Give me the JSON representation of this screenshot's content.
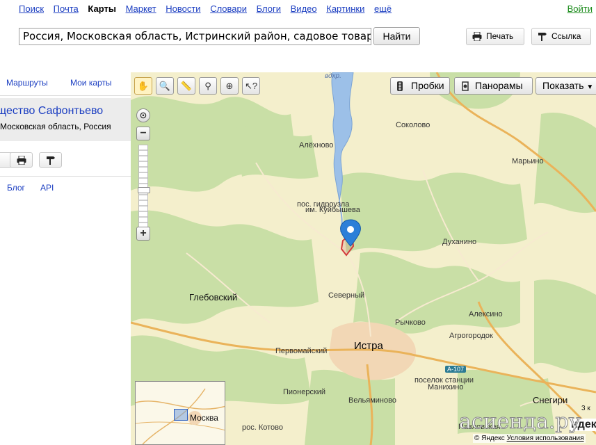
{
  "nav": {
    "items": [
      "Поиск",
      "Почта",
      "Карты",
      "Маркет",
      "Новости",
      "Словари",
      "Блоги",
      "Видео",
      "Картинки",
      "ещё"
    ],
    "login": "Войти"
  },
  "search": {
    "value": "Россия, Московская область, Истринский район, садовое товарищество Сафонтьево",
    "button": "Найти"
  },
  "actions": {
    "print": "Печать",
    "link": "Ссылка"
  },
  "panel": {
    "tabs": [
      "Маршруты",
      "Мои карты"
    ],
    "result_title": "щество Сафонтьево",
    "result_subtitle": "Московская область, Россия",
    "links": [
      "Блог",
      "API"
    ]
  },
  "map_controls": {
    "traffic": "Пробки",
    "panoramas": "Панорамы",
    "show": "Показать"
  },
  "places": {
    "water": "вдхр.",
    "sokolovo": "Соколово",
    "alekhnovo": "Алёхново",
    "marino": "Марьино",
    "gidrouzel1": "пос. гидроузла",
    "gidrouzel2": "им. Куйбышева",
    "dukhanino": "Духанино",
    "glebovsky": "Глебовский",
    "severny": "Северный",
    "rychkovo": "Рычково",
    "aleksino": "Алексино",
    "agrogorodok": "Агрогородок",
    "pervomaysky": "Первомайский",
    "istra": "Истра",
    "road": "А-107",
    "manikhino1": "поселок станции",
    "manikhino2": "Манихино",
    "pionersky": "Пионерский",
    "velyaminovo": "Вельяминово",
    "snegiri": "Снегири",
    "kotovo": "рос. Котово",
    "pavlovskaya": "Павловская",
    "moskva": "Москва"
  },
  "footer": {
    "copyright": "© Яндекс",
    "terms": "Условия использования",
    "watermark": "асиенда.ру",
    "scale": "3 к",
    "brand_partial": "ндекс"
  }
}
